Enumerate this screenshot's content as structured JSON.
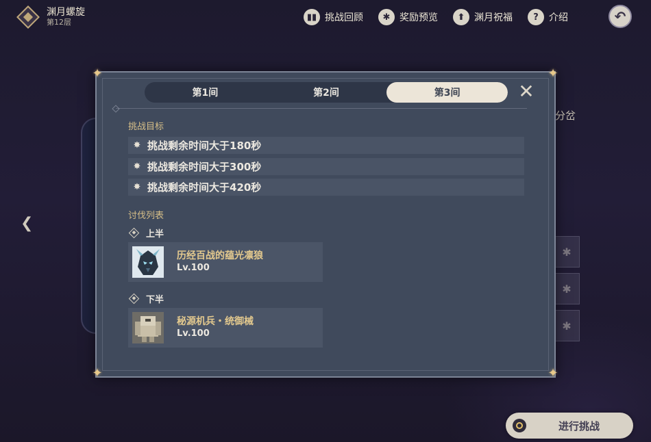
{
  "header": {
    "title": "渊月螺旋",
    "floor": "第12层",
    "icon": "abyss-icon"
  },
  "top_nav": [
    {
      "label": "挑战回顾",
      "icon": "book-icon",
      "glyph": "▮▮"
    },
    {
      "label": "奖励预览",
      "icon": "star-badge-icon",
      "glyph": "✱"
    },
    {
      "label": "渊月祝福",
      "icon": "upgrade-arrow-icon",
      "glyph": "⬆"
    },
    {
      "label": "介绍",
      "icon": "help-icon",
      "glyph": "?"
    }
  ],
  "background": {
    "side_label": "分岔"
  },
  "modal": {
    "tabs": [
      {
        "label": "第1间",
        "active": false
      },
      {
        "label": "第2间",
        "active": false
      },
      {
        "label": "第3间",
        "active": true
      }
    ],
    "objectives_title": "挑战目标",
    "objectives": [
      "挑战剩余时间大于180秒",
      "挑战剩余时间大于300秒",
      "挑战剩余时间大于420秒"
    ],
    "enemy_list_title": "讨伐列表",
    "halves": [
      {
        "label": "上半",
        "enemy": {
          "name": "历经百战的蕴光凛狼",
          "level": "Lv.100"
        }
      },
      {
        "label": "下半",
        "enemy": {
          "name": "秘源机兵・统御械",
          "level": "Lv.100"
        }
      }
    ]
  },
  "start_button": {
    "label": "进行挑战"
  },
  "colors": {
    "accent_gold": "#e3c98e",
    "modal_bg": "#404a5c",
    "tab_active": "#ece5d8"
  }
}
